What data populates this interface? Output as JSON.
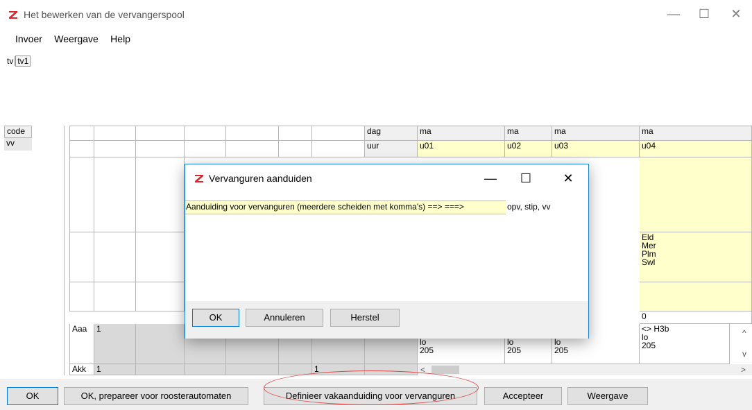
{
  "window": {
    "title": "Het bewerken van de vervangerspool",
    "minimize": "—",
    "maximize": "☐",
    "close": "✕"
  },
  "menu": [
    "Invoer",
    "Weergave",
    "Help"
  ],
  "tabs": [
    "tv",
    "tv1"
  ],
  "grid": {
    "left_labels": [
      "code",
      "vv"
    ],
    "row_labels": [
      "dag",
      "uur"
    ],
    "days": [
      "ma",
      "ma",
      "ma",
      "ma"
    ],
    "hours": [
      "u01",
      "u02",
      "u03",
      "u04"
    ],
    "col4_block": [
      "Eld",
      "Mer",
      "Plm",
      "Swl"
    ],
    "col4_zero": "0",
    "col4_lower": [
      "<> H3b",
      "lo",
      "205"
    ],
    "lower_cells": [
      [
        "lo",
        "205"
      ],
      [
        "lo",
        "205"
      ],
      [
        "lo",
        "205"
      ]
    ],
    "rows": [
      {
        "name": "Aaa",
        "value": "1"
      },
      {
        "name": "Akk",
        "value": "1",
        "extra": "1"
      }
    ],
    "scroll_left": "<",
    "scroll_right": ">",
    "scroll_up": "^",
    "scroll_down": "v"
  },
  "dialog": {
    "title": "Vervanguren aanduiden",
    "minimize": "—",
    "maximize": "☐",
    "close": "✕",
    "label": "Aanduiding voor vervanguren (meerdere scheiden met komma's) ==>  ===>",
    "value": "opv, stip, vv",
    "buttons": {
      "ok": "OK",
      "cancel": "Annuleren",
      "reset": "Herstel"
    }
  },
  "bottom_buttons": {
    "ok": "OK",
    "ok_prepare": "OK, prepareer voor roosterautomaten",
    "define": "Definieer vakaanduiding voor vervanguren",
    "accept": "Accepteer",
    "view": "Weergave"
  },
  "colors": {
    "accent": "#0078d7",
    "highlight_ellipse": "#e0494a",
    "cell_yellow": "#ffffcc",
    "logo_red": "#d9262e"
  }
}
